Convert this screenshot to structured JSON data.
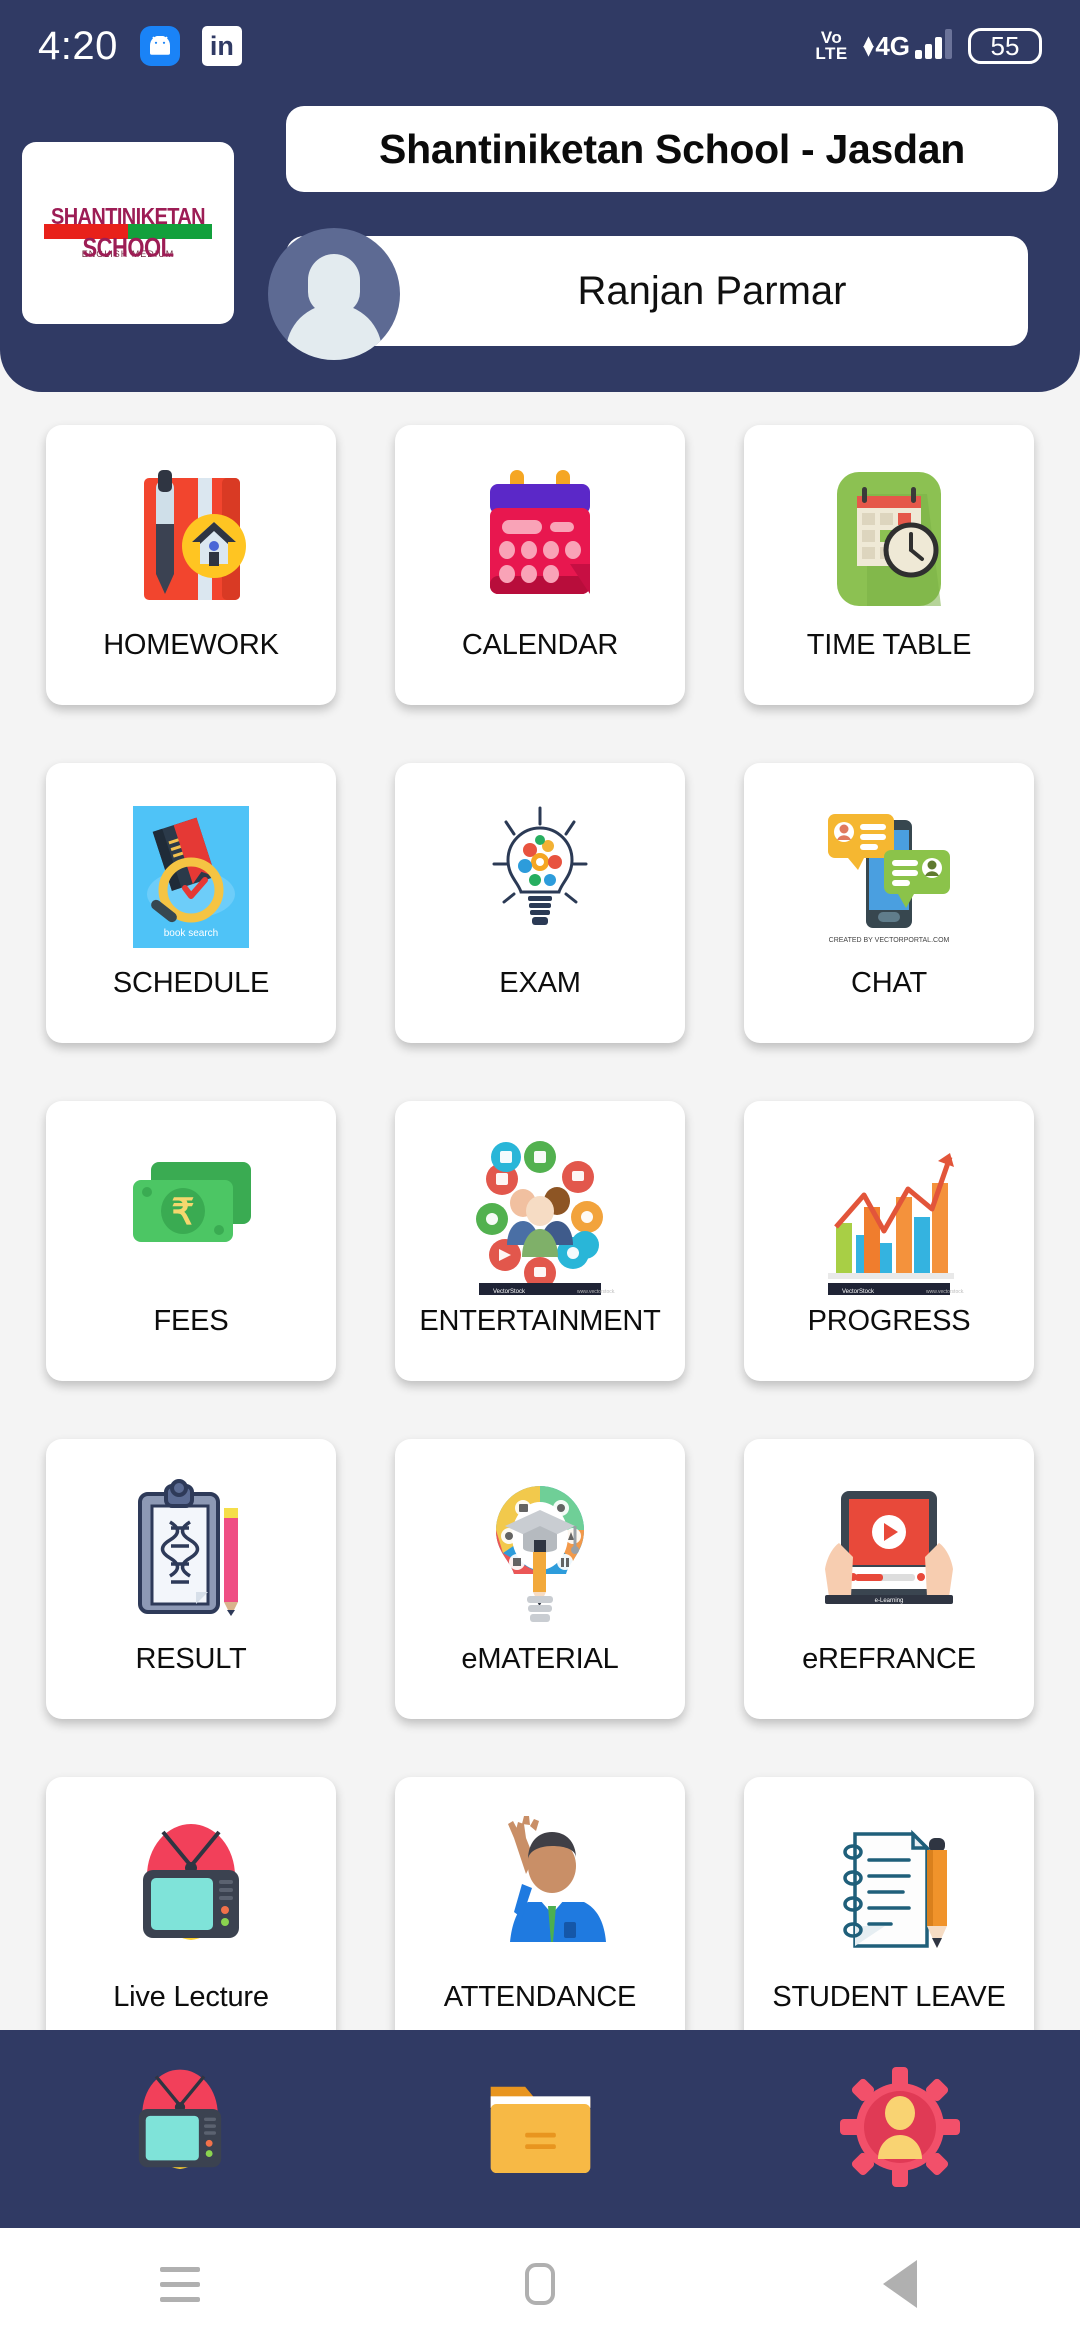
{
  "status_bar": {
    "time": "4:20",
    "icons": [
      "android-robot-icon",
      "linkedin-icon"
    ],
    "volte": "Vo",
    "volte2": "LTE",
    "network": "4G",
    "battery": "55"
  },
  "header": {
    "logo": {
      "line1": "SHANTINIKETAN",
      "line2": "SCHOOL",
      "line3": "ENGLISH MEDIUM",
      "color_text": "#9d1d55",
      "color_red": "#e8211a",
      "color_green": "#12a03c"
    },
    "school_title": "Shantiniketan School - Jasdan",
    "user_name": "Ranjan Parmar",
    "background": "#303a64"
  },
  "grid": {
    "tiles": [
      {
        "label": "HOMEWORK",
        "icon": "homework-book-pen-icon"
      },
      {
        "label": "CALENDAR",
        "icon": "calendar-icon"
      },
      {
        "label": "TIME TABLE",
        "icon": "timetable-calendar-clock-icon"
      },
      {
        "label": "SCHEDULE",
        "icon": "book-search-magnifier-icon"
      },
      {
        "label": "EXAM",
        "icon": "lightbulb-gears-icon"
      },
      {
        "label": "CHAT",
        "icon": "phone-chat-bubbles-icon"
      },
      {
        "label": "FEES",
        "icon": "rupee-banknote-icon"
      },
      {
        "label": "ENTERTAINMENT",
        "icon": "social-people-circle-icon"
      },
      {
        "label": "PROGRESS",
        "icon": "bar-chart-arrow-icon"
      },
      {
        "label": "RESULT",
        "icon": "clipboard-pencil-icon"
      },
      {
        "label": "eMATERIAL",
        "icon": "graduation-lightbulb-icon"
      },
      {
        "label": "eREFRANCE",
        "icon": "tablet-video-play-icon"
      },
      {
        "label": "Live Lecture",
        "icon": "retro-tv-icon"
      },
      {
        "label": "ATTENDANCE",
        "icon": "raised-hand-student-icon"
      },
      {
        "label": "STUDENT LEAVE",
        "icon": "notepad-pen-icon"
      }
    ]
  },
  "bottom_nav": {
    "items": [
      {
        "icon": "retro-tv-icon"
      },
      {
        "icon": "folder-icon"
      },
      {
        "icon": "gear-user-settings-icon"
      }
    ],
    "background": "#303a64"
  },
  "android_nav": {
    "recents": "recents-icon",
    "home": "home-icon",
    "back": "back-icon"
  }
}
